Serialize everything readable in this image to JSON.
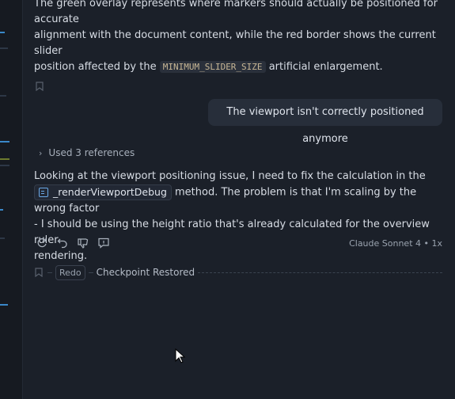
{
  "assistant_prev": {
    "line1": "The green overlay represents where markers should actually be positioned for accurate",
    "line2": "alignment with the document content, while the red border shows the current slider",
    "line3_pre": "position affected by the ",
    "code": "MINIMUM_SLIDER_SIZE",
    "line3_post": " artificial enlargement."
  },
  "user_message": "The viewport isn't correctly positioned anymore",
  "references": {
    "label": "Used 3 references"
  },
  "assistant_reply": {
    "line1": "Looking at the viewport positioning issue, I need to fix the calculation in the",
    "symbol": "_renderViewportDebug",
    "line2_post": " method. The problem is that I'm scaling by the wrong factor",
    "line3": "- I should be using the height ratio that's already calculated for the overview ruler",
    "line4": "rendering."
  },
  "model_info": "Claude Sonnet 4 • 1x",
  "checkpoint": {
    "redo_label": "Redo",
    "label": "Checkpoint Restored"
  },
  "icons": [
    "bookmark-icon",
    "retry-icon",
    "undo-icon",
    "thumbs-down-icon",
    "comment-icon",
    "chevron-right-icon",
    "method-symbol-icon",
    "mouse-cursor-icon"
  ],
  "colors": {
    "panel": "#1b2029",
    "bubble": "#272e3a",
    "accent": "#3a88c9"
  }
}
